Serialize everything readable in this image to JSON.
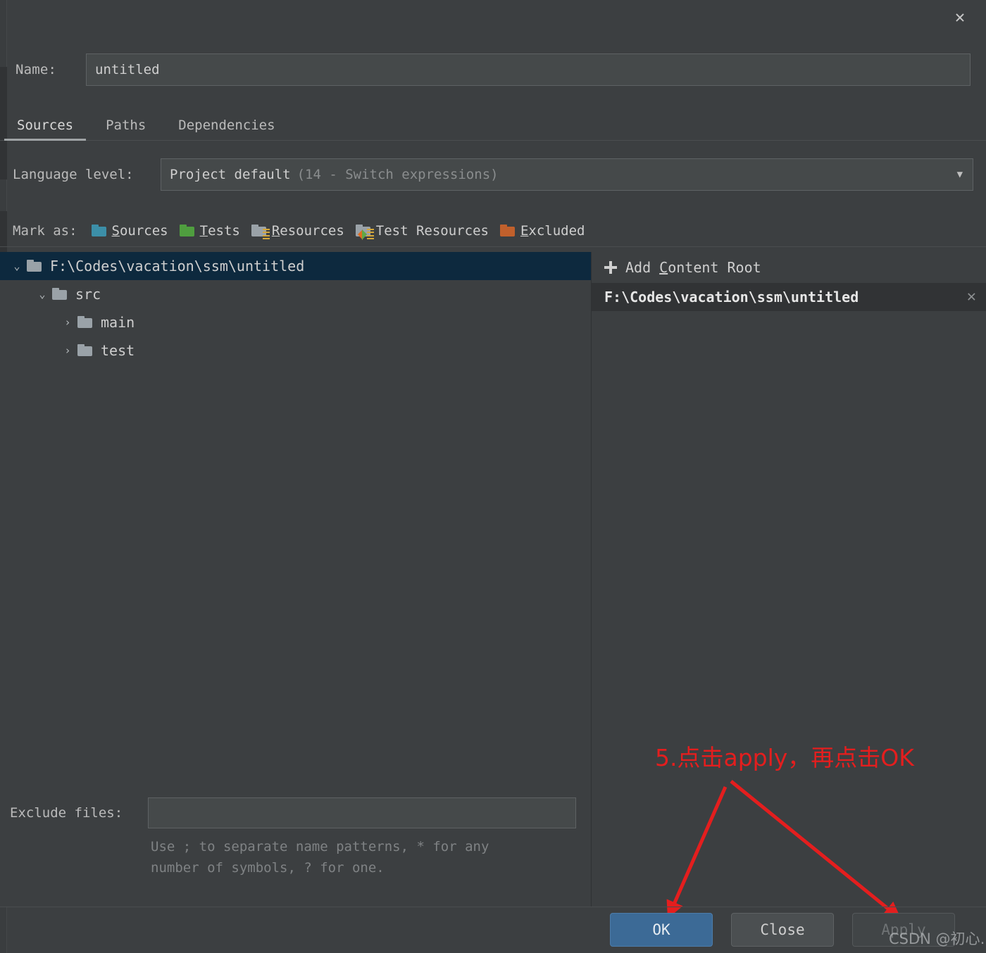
{
  "window": {
    "close_icon": "close-icon",
    "close_glyph": "✕"
  },
  "name_row": {
    "label": "Name:",
    "value": "untitled",
    "placeholder": ""
  },
  "tabs": [
    {
      "label": "Sources",
      "active": true
    },
    {
      "label": "Paths",
      "active": false
    },
    {
      "label": "Dependencies",
      "active": false
    }
  ],
  "language_level": {
    "label": "Language level:",
    "value": "Project default",
    "hint": "(14 - Switch expressions)",
    "arrow_glyph": "▼"
  },
  "mark_as": {
    "label": "Mark as:",
    "items": [
      {
        "label": "Sources",
        "mnemonic": "S",
        "icon": "folder-sources-icon",
        "color": "#3C8FA8"
      },
      {
        "label": "Tests",
        "mnemonic": "T",
        "icon": "folder-tests-icon",
        "color": "#4F9E3F"
      },
      {
        "label": "Resources",
        "mnemonic": "R",
        "icon": "folder-resources-icon",
        "color": "#9AA2A8"
      },
      {
        "label": "Test Resources",
        "mnemonic": "",
        "icon": "folder-test-resources-icon",
        "color": "#9AA2A8"
      },
      {
        "label": "Excluded",
        "mnemonic": "E",
        "icon": "folder-excluded-icon",
        "color": "#C1602C"
      }
    ]
  },
  "tree": {
    "nodes": [
      {
        "label": "F:\\Codes\\vacation\\ssm\\untitled",
        "depth": 0,
        "chevron": "⌄",
        "expanded": true,
        "selected": true
      },
      {
        "label": "src",
        "depth": 1,
        "chevron": "⌄",
        "expanded": true,
        "selected": false
      },
      {
        "label": "main",
        "depth": 2,
        "chevron": "›",
        "expanded": false,
        "selected": false
      },
      {
        "label": "test",
        "depth": 2,
        "chevron": "›",
        "expanded": false,
        "selected": false
      }
    ]
  },
  "exclude": {
    "label": "Exclude files:",
    "value": "",
    "hint_line1": "Use ; to separate name patterns, * for any",
    "hint_line2": "number of symbols, ? for one."
  },
  "content_roots": {
    "add_label_pre": "Add ",
    "add_label_mnemonic": "C",
    "add_label_post": "ontent Root",
    "add_icon": "plus-icon",
    "items": [
      {
        "path": "F:\\Codes\\vacation\\ssm\\untitled",
        "remove_glyph": "✕"
      }
    ]
  },
  "annotation": {
    "text": "5.点击apply，再点击OK",
    "color": "#E41E1E"
  },
  "buttons": [
    {
      "label": "OK",
      "style": "primary",
      "name": "ok-button"
    },
    {
      "label": "Close",
      "style": "normal",
      "name": "close-button"
    },
    {
      "label": "Apply",
      "style": "disabled",
      "name": "apply-button"
    }
  ],
  "watermark": {
    "text": "CSDN @初心…%"
  }
}
